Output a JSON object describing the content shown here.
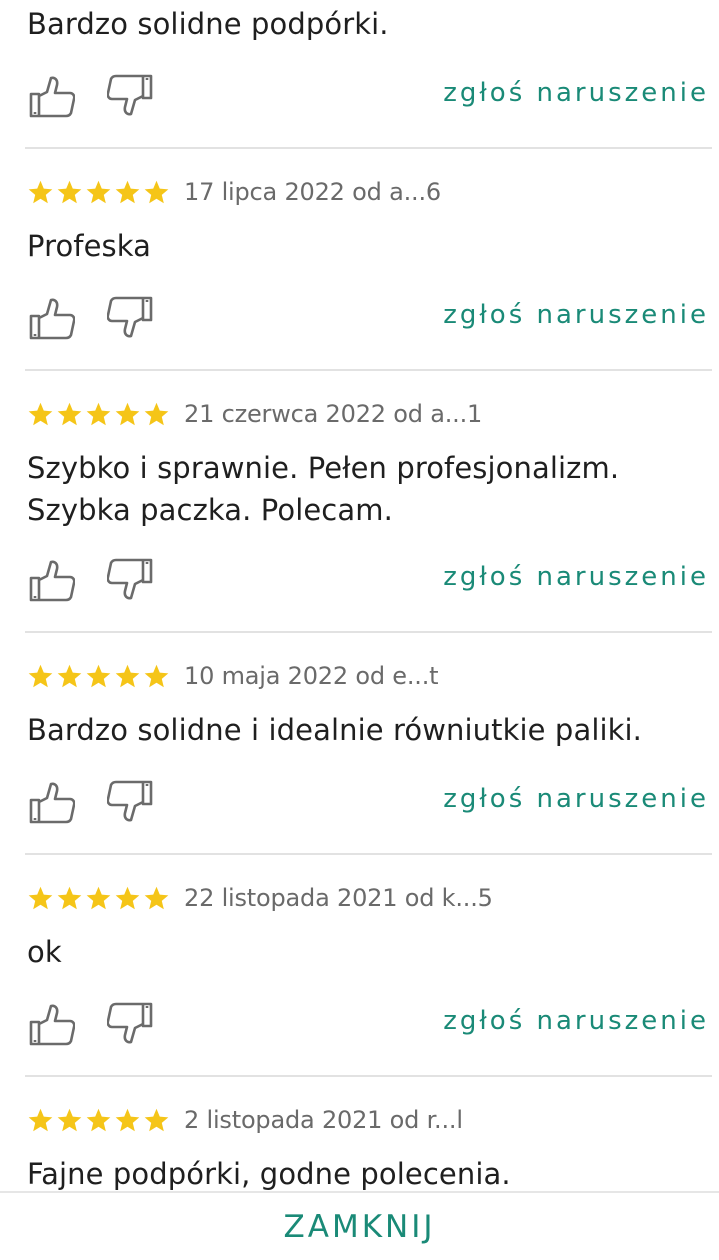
{
  "colors": {
    "accent": "#1a8a77",
    "star": "#f5c518",
    "text": "#1f1f1f",
    "meta": "#6a6a6a",
    "icon": "#6b6b6b",
    "divider": "#e2e2e2"
  },
  "rating_max": 5,
  "report_label": "zgłoś naruszenie",
  "reviews": [
    {
      "rating": 5,
      "date_author": "",
      "text": "Bardzo solidne podpórki."
    },
    {
      "rating": 5,
      "date_author": "17 lipca 2022 od a...6",
      "text": "Profeska"
    },
    {
      "rating": 5,
      "date_author": "21 czerwca 2022 od a...1",
      "text": "Szybko i sprawnie. Pełen profesjonalizm. Szybka paczka. Polecam."
    },
    {
      "rating": 5,
      "date_author": "10 maja 2022 od e...t",
      "text": "Bardzo solidne i idealnie równiutkie paliki."
    },
    {
      "rating": 5,
      "date_author": "22 listopada 2021 od k...5",
      "text": "ok"
    },
    {
      "rating": 5,
      "date_author": "2 listopada 2021 od r...l",
      "text": "Fajne podpórki, godne polecenia."
    }
  ],
  "footer": {
    "close_label": "ZAMKNIJ"
  }
}
